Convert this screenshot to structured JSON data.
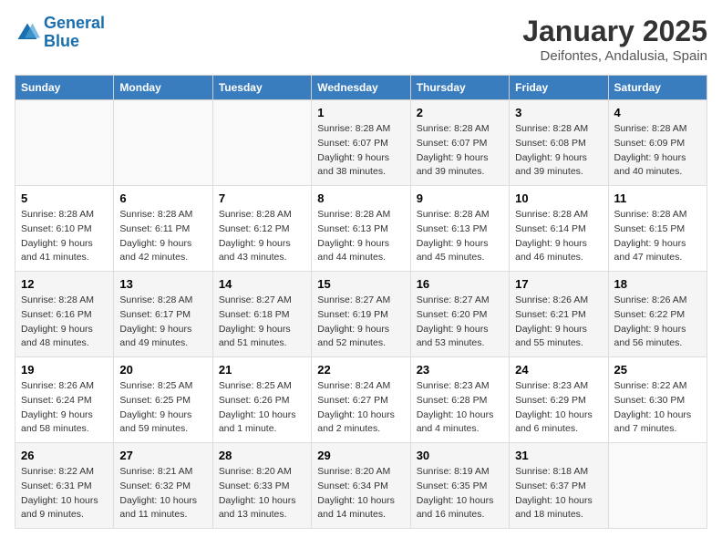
{
  "logo": {
    "line1": "General",
    "line2": "Blue"
  },
  "title": "January 2025",
  "subtitle": "Deifontes, Andalusia, Spain",
  "days_of_week": [
    "Sunday",
    "Monday",
    "Tuesday",
    "Wednesday",
    "Thursday",
    "Friday",
    "Saturday"
  ],
  "weeks": [
    [
      {
        "day": "",
        "info": ""
      },
      {
        "day": "",
        "info": ""
      },
      {
        "day": "",
        "info": ""
      },
      {
        "day": "1",
        "info": "Sunrise: 8:28 AM\nSunset: 6:07 PM\nDaylight: 9 hours\nand 38 minutes."
      },
      {
        "day": "2",
        "info": "Sunrise: 8:28 AM\nSunset: 6:07 PM\nDaylight: 9 hours\nand 39 minutes."
      },
      {
        "day": "3",
        "info": "Sunrise: 8:28 AM\nSunset: 6:08 PM\nDaylight: 9 hours\nand 39 minutes."
      },
      {
        "day": "4",
        "info": "Sunrise: 8:28 AM\nSunset: 6:09 PM\nDaylight: 9 hours\nand 40 minutes."
      }
    ],
    [
      {
        "day": "5",
        "info": "Sunrise: 8:28 AM\nSunset: 6:10 PM\nDaylight: 9 hours\nand 41 minutes."
      },
      {
        "day": "6",
        "info": "Sunrise: 8:28 AM\nSunset: 6:11 PM\nDaylight: 9 hours\nand 42 minutes."
      },
      {
        "day": "7",
        "info": "Sunrise: 8:28 AM\nSunset: 6:12 PM\nDaylight: 9 hours\nand 43 minutes."
      },
      {
        "day": "8",
        "info": "Sunrise: 8:28 AM\nSunset: 6:13 PM\nDaylight: 9 hours\nand 44 minutes."
      },
      {
        "day": "9",
        "info": "Sunrise: 8:28 AM\nSunset: 6:13 PM\nDaylight: 9 hours\nand 45 minutes."
      },
      {
        "day": "10",
        "info": "Sunrise: 8:28 AM\nSunset: 6:14 PM\nDaylight: 9 hours\nand 46 minutes."
      },
      {
        "day": "11",
        "info": "Sunrise: 8:28 AM\nSunset: 6:15 PM\nDaylight: 9 hours\nand 47 minutes."
      }
    ],
    [
      {
        "day": "12",
        "info": "Sunrise: 8:28 AM\nSunset: 6:16 PM\nDaylight: 9 hours\nand 48 minutes."
      },
      {
        "day": "13",
        "info": "Sunrise: 8:28 AM\nSunset: 6:17 PM\nDaylight: 9 hours\nand 49 minutes."
      },
      {
        "day": "14",
        "info": "Sunrise: 8:27 AM\nSunset: 6:18 PM\nDaylight: 9 hours\nand 51 minutes."
      },
      {
        "day": "15",
        "info": "Sunrise: 8:27 AM\nSunset: 6:19 PM\nDaylight: 9 hours\nand 52 minutes."
      },
      {
        "day": "16",
        "info": "Sunrise: 8:27 AM\nSunset: 6:20 PM\nDaylight: 9 hours\nand 53 minutes."
      },
      {
        "day": "17",
        "info": "Sunrise: 8:26 AM\nSunset: 6:21 PM\nDaylight: 9 hours\nand 55 minutes."
      },
      {
        "day": "18",
        "info": "Sunrise: 8:26 AM\nSunset: 6:22 PM\nDaylight: 9 hours\nand 56 minutes."
      }
    ],
    [
      {
        "day": "19",
        "info": "Sunrise: 8:26 AM\nSunset: 6:24 PM\nDaylight: 9 hours\nand 58 minutes."
      },
      {
        "day": "20",
        "info": "Sunrise: 8:25 AM\nSunset: 6:25 PM\nDaylight: 9 hours\nand 59 minutes."
      },
      {
        "day": "21",
        "info": "Sunrise: 8:25 AM\nSunset: 6:26 PM\nDaylight: 10 hours\nand 1 minute."
      },
      {
        "day": "22",
        "info": "Sunrise: 8:24 AM\nSunset: 6:27 PM\nDaylight: 10 hours\nand 2 minutes."
      },
      {
        "day": "23",
        "info": "Sunrise: 8:23 AM\nSunset: 6:28 PM\nDaylight: 10 hours\nand 4 minutes."
      },
      {
        "day": "24",
        "info": "Sunrise: 8:23 AM\nSunset: 6:29 PM\nDaylight: 10 hours\nand 6 minutes."
      },
      {
        "day": "25",
        "info": "Sunrise: 8:22 AM\nSunset: 6:30 PM\nDaylight: 10 hours\nand 7 minutes."
      }
    ],
    [
      {
        "day": "26",
        "info": "Sunrise: 8:22 AM\nSunset: 6:31 PM\nDaylight: 10 hours\nand 9 minutes."
      },
      {
        "day": "27",
        "info": "Sunrise: 8:21 AM\nSunset: 6:32 PM\nDaylight: 10 hours\nand 11 minutes."
      },
      {
        "day": "28",
        "info": "Sunrise: 8:20 AM\nSunset: 6:33 PM\nDaylight: 10 hours\nand 13 minutes."
      },
      {
        "day": "29",
        "info": "Sunrise: 8:20 AM\nSunset: 6:34 PM\nDaylight: 10 hours\nand 14 minutes."
      },
      {
        "day": "30",
        "info": "Sunrise: 8:19 AM\nSunset: 6:35 PM\nDaylight: 10 hours\nand 16 minutes."
      },
      {
        "day": "31",
        "info": "Sunrise: 8:18 AM\nSunset: 6:37 PM\nDaylight: 10 hours\nand 18 minutes."
      },
      {
        "day": "",
        "info": ""
      }
    ]
  ]
}
